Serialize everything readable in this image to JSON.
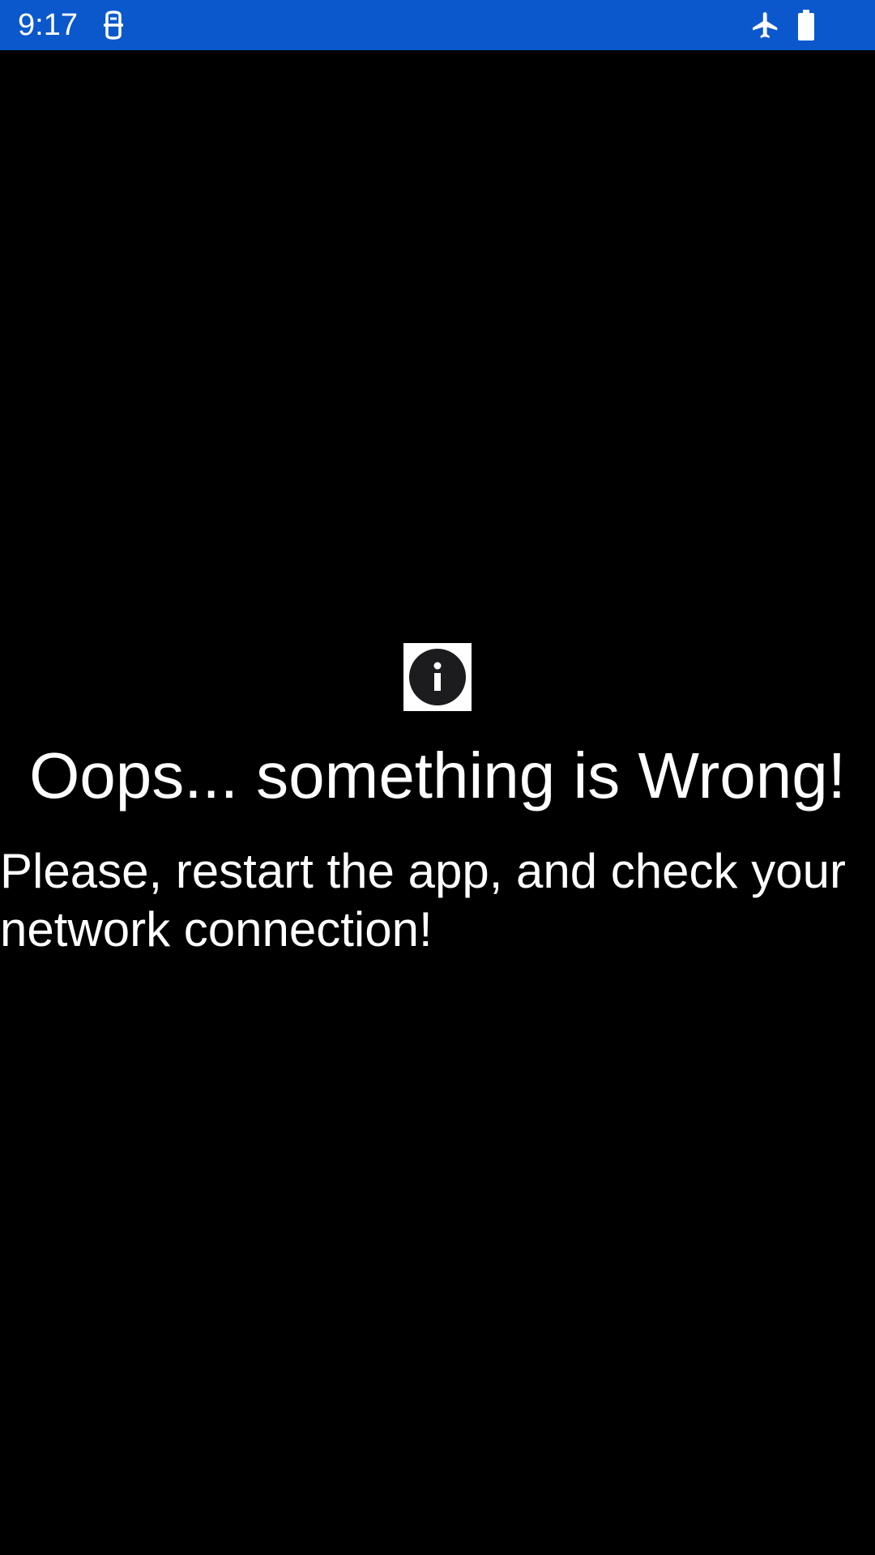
{
  "status_bar": {
    "time": "9:17",
    "background_color": "#0b58cc",
    "icons": [
      "notification-icon",
      "airplane-mode-icon",
      "battery-icon"
    ]
  },
  "error": {
    "icon": "info-icon",
    "title": "Oops... something is Wrong!",
    "message_lines": [
      "Please, restart the app, and check your",
      "network connection!"
    ]
  },
  "colors": {
    "background": "#000000",
    "text": "#ffffff"
  }
}
